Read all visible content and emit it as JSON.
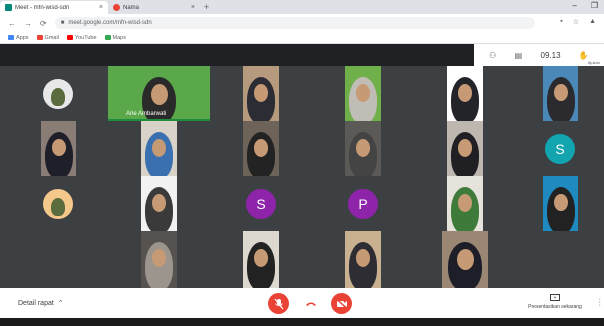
{
  "browser": {
    "tabs": [
      {
        "title": "Meet - mfn-wisd-sdn",
        "active": true
      },
      {
        "title": "Nama",
        "active": false
      }
    ],
    "new_tab": "+",
    "window_controls": [
      "–",
      "❐"
    ],
    "address": "meet.google.com/mfn-wisd-sdn",
    "bookmarks": [
      {
        "label": "Apps",
        "color": "#4285f4"
      },
      {
        "label": "Gmail",
        "color": "#ea4335"
      },
      {
        "label": "YouTube",
        "color": "#ff0000"
      },
      {
        "label": "Maps",
        "color": "#34a853"
      }
    ]
  },
  "meet": {
    "time": "09.13",
    "request_label": "Ajukan",
    "participants": [
      {
        "type": "avatar-photo",
        "bg": "#3c4043",
        "avatar_bg": "#e8e8e8"
      },
      {
        "type": "video",
        "name": "Arie Ambarwati",
        "bg": "#5aa84a",
        "hijab": "#2a2a2a",
        "speaking": true
      },
      {
        "type": "video",
        "bg": "#b59a7e",
        "hijab": "#2c2c34"
      },
      {
        "type": "video",
        "bg": "#6fb04a",
        "hijab": "#c0bdb6"
      },
      {
        "type": "video",
        "bg": "#ffffff",
        "hijab": "#23232a"
      },
      {
        "type": "video",
        "bg": "#4a88b8",
        "hijab": "#2b2b2f"
      },
      {
        "type": "video",
        "bg": "#8a7d75",
        "hijab": "#1f1f2a"
      },
      {
        "type": "video",
        "bg": "#d8d2c8",
        "hijab": "#3a6fb0"
      },
      {
        "type": "video",
        "bg": "#6e6358",
        "hijab": "#232323"
      },
      {
        "type": "video",
        "bg": "#5c5a57",
        "hijab": "#444"
      },
      {
        "type": "video",
        "bg": "#bdb7b0",
        "hijab": "#1f1f24"
      },
      {
        "type": "letter",
        "letter": "S",
        "avatar_bg": "#12a4af"
      },
      {
        "type": "avatar-photo",
        "bg": "#3c4043",
        "avatar_bg": "#f4c88a"
      },
      {
        "type": "video",
        "bg": "#f2f2f2",
        "hijab": "#3a3a3a"
      },
      {
        "type": "letter",
        "letter": "S",
        "avatar_bg": "#8e24aa"
      },
      {
        "type": "letter",
        "letter": "P",
        "avatar_bg": "#8e24aa"
      },
      {
        "type": "video",
        "bg": "#e6e3dc",
        "hijab": "#3e7b3a"
      },
      {
        "type": "video",
        "bg": "#1f8ac0",
        "hijab": "#222"
      },
      {
        "type": "video",
        "bg": "#555250",
        "hijab": "#9c958d"
      },
      {
        "type": "video",
        "bg": "#dcd7cf",
        "hijab": "#222"
      },
      {
        "type": "video",
        "bg": "#c8b090",
        "hijab": "#2d2d33"
      },
      {
        "type": "video",
        "bg": "#9a8672",
        "hijab": "#1e1e28"
      }
    ]
  },
  "bottom": {
    "details_label": "Detail rapat",
    "present_label": "Presentasikan sekarang",
    "present_icon": "+"
  },
  "colors": {
    "end_call": "#ea4335",
    "speaking": "#1e8e3e"
  }
}
